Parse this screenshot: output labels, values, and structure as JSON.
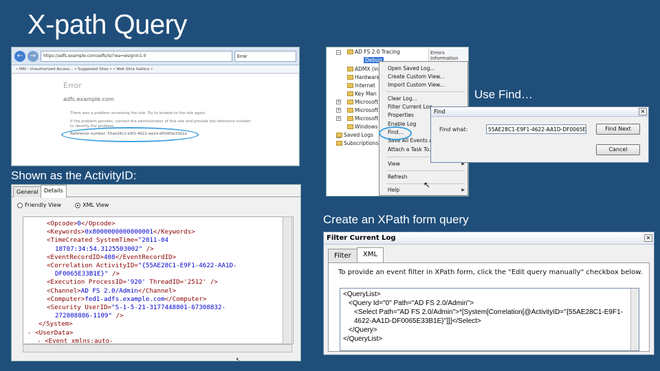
{
  "slide": {
    "title": "X-path Query",
    "caption_activity": "Shown as the ActivityID:",
    "caption_find": "Use Find…",
    "caption_xpath": "Create an XPath form query"
  },
  "browser": {
    "address": "https://adfs.example.com/adfs/ls/?wa=wsignin1.0",
    "tab_label": "Error",
    "favorites": "• MRI - Unauthorized Access...  • Suggested Sites •  • Web Slice Gallery •",
    "error_title": "Error",
    "error_host": "adfs.example.com",
    "line1": "There was a problem accessing the site. Try to browse to the site again.",
    "line2": "If the problem persists, contact the administrator of this site and provide the reference number",
    "line3": "to identify the problem.",
    "reference_label": "Reference number:",
    "reference_value": "55ae28c1-e9f1-4622-aa1d-df0065e33b1e"
  },
  "eventviewer": {
    "tree": [
      "AD FS 2.0 Tracing",
      "ADMX (in",
      "Hardware",
      "Internet",
      "Key Man",
      "Microsoft",
      "Microsoft",
      "Microsoft",
      "Windows",
      "Saved Logs",
      "Subscriptions"
    ],
    "selected": "Debug",
    "right_col": [
      "Errors",
      "Information"
    ],
    "menu": {
      "open_saved": "Open Saved Log...",
      "create_view": "Create Custom View...",
      "import_view": "Import Custom View...",
      "clear_log": "Clear Log...",
      "filter": "Filter Current Log...",
      "properties": "Properties",
      "enable_log": "Enable Log",
      "find": "Find...",
      "save_all": "Save All Events A...",
      "attach_task": "Attach a Task To...",
      "view": "View",
      "refresh": "Refresh",
      "help": "Help"
    }
  },
  "find": {
    "title": "Find",
    "label": "Find what:",
    "value": "55AE28C1-E9F1-4622-AA1D-DF0065E",
    "find_next": "Find Next",
    "cancel": "Cancel"
  },
  "xmlview": {
    "tab_general": "General",
    "tab_details": "Details",
    "friendly": "Friendly View",
    "xml": "XML View",
    "lines": [
      {
        "pre": "<Opcode>",
        "val": "0",
        "post": "</Opcode>"
      },
      {
        "pre": "<Keywords>",
        "val": "0x8000000000000001",
        "post": "</Keywords>"
      },
      {
        "pre": "<TimeCreated SystemTime=",
        "val": "\"2011-04",
        "post": ""
      },
      {
        "pre": "",
        "val": "18T07:34:54.3125503002\"",
        "post": " />"
      },
      {
        "pre": "<EventRecordID>",
        "val": "408",
        "post": "</EventRecordID>"
      },
      {
        "pre": "<Correlation ActivityID=",
        "val": "\"{55AE28C1-E9F1-4622-AA1D-",
        "post": ""
      },
      {
        "pre": "",
        "val": "DF0065E33B1E}\"",
        "post": " />"
      },
      {
        "pre": "<Execution ProcessID=",
        "val": "'920'",
        "post": " ThreadID='2512' />"
      },
      {
        "pre": "<Channel>",
        "val": "AD FS 2.0/Admin",
        "post": "</Channel>"
      },
      {
        "pre": "<Computer>",
        "val": "fed1-adfs.example.com",
        "post": "</Computer>"
      },
      {
        "pre": "<Security UserID=",
        "val": "\"S-1-5-21-3177448801-67308832-",
        "post": ""
      },
      {
        "pre": "",
        "val": "272808886-1109\"",
        "post": " />"
      },
      {
        "pre": "</System>",
        "val": "",
        "post": ""
      },
      {
        "pre": "- <UserData>",
        "val": "",
        "post": ""
      },
      {
        "pre": "- <Event xmlns:auto-",
        "val": "",
        "post": ""
      }
    ]
  },
  "filter": {
    "title": "Filter Current Log",
    "tab_filter": "Filter",
    "tab_xml": "XML",
    "instruction": "To provide an event filter in XPath form, click the \"Edit query manually\" checkbox below.",
    "query": [
      "<QueryList>",
      "<Query Id=\"0\" Path=\"AD FS 2.0/Admin\">",
      "<Select Path=\"AD FS 2.0/Admin\">*[System[Correlation[@ActivityID=\"{55AE28C1-E9F1-",
      "4622-AA1D-DF0065E33B1E}\"]]]</Select>",
      "</Query>",
      "</QueryList>"
    ]
  }
}
